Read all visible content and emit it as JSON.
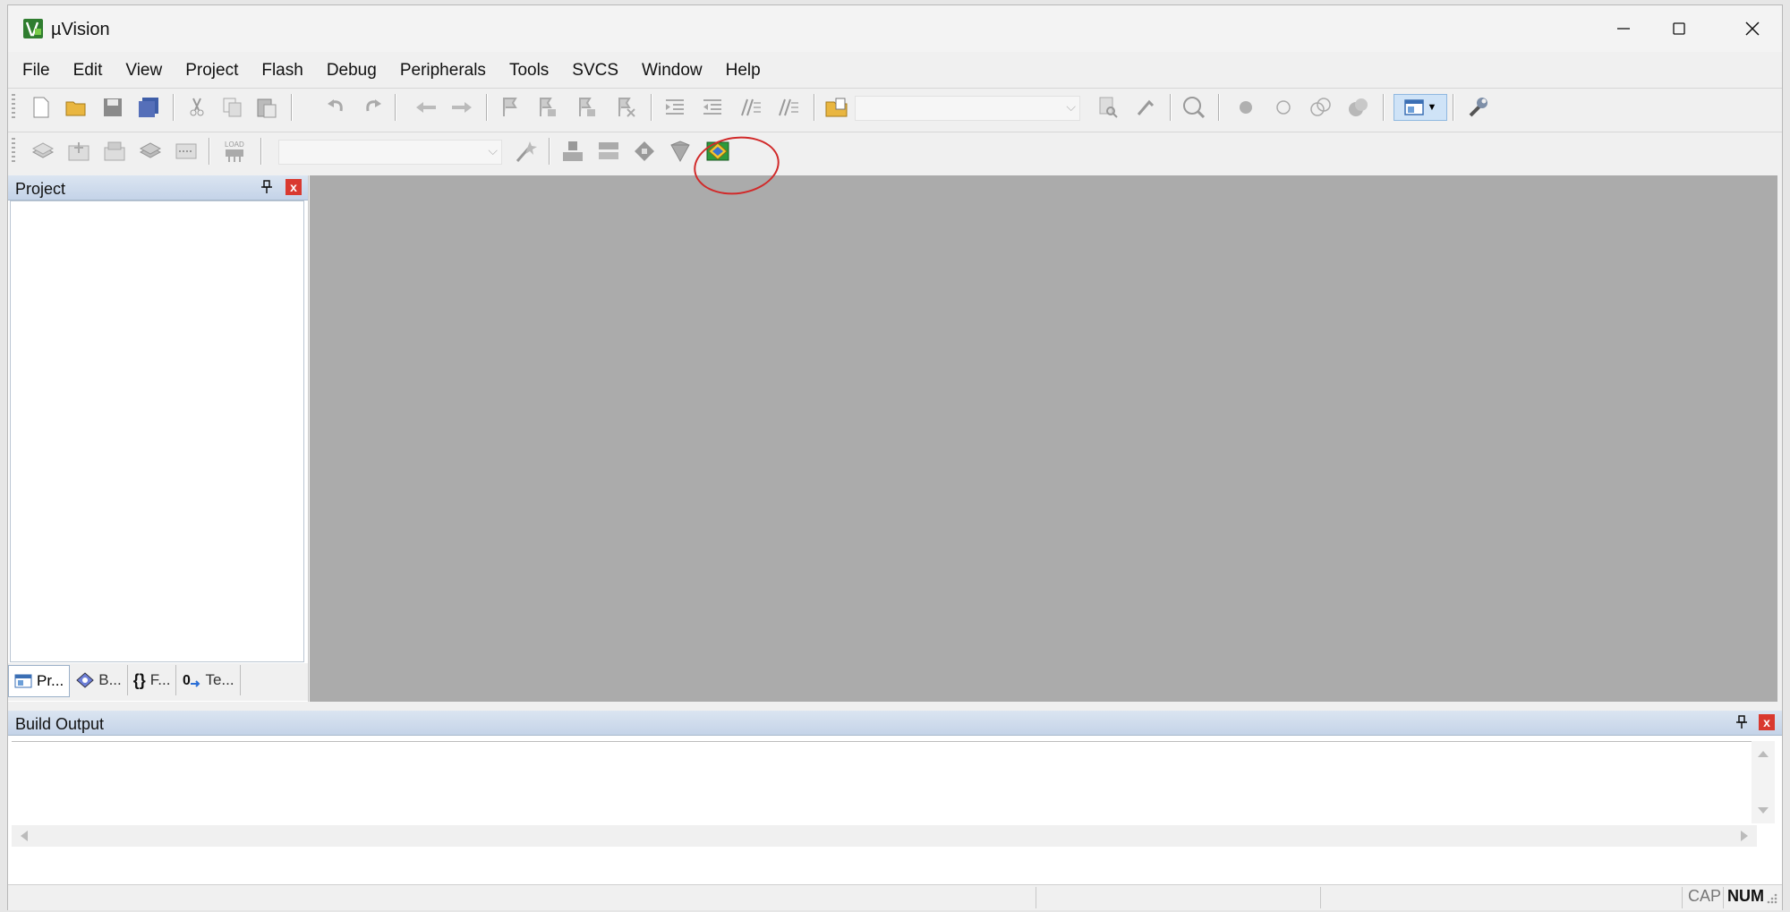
{
  "window": {
    "title": "µVision",
    "accent": "#3a8b3a"
  },
  "menubar": [
    "File",
    "Edit",
    "View",
    "Project",
    "Flash",
    "Debug",
    "Peripherals",
    "Tools",
    "SVCS",
    "Window",
    "Help"
  ],
  "toolbar1": [
    "new-file-icon",
    "open-folder-icon",
    "save-icon",
    "save-all-icon",
    "cut-icon",
    "copy-icon",
    "paste-icon",
    "undo-icon",
    "redo-icon",
    "nav-back-icon",
    "nav-forward-icon",
    "bookmark-icon",
    "prev-bookmark-icon",
    "next-bookmark-icon",
    "clear-bookmarks-icon",
    "indent-icon",
    "unindent-icon",
    "comment-icon",
    "uncomment-icon",
    "find-in-files-icon",
    "find-combo",
    "incremental-find-icon",
    "find-icon",
    "debug-session-icon",
    "breakpoint-icon",
    "disable-breakpoint-icon",
    "disable-all-breakpoints-icon",
    "kill-breakpoints-icon",
    "window-layout-icon",
    "configure-icon"
  ],
  "toolbar2": [
    "translate-icon",
    "build-icon",
    "rebuild-icon",
    "batch-build-icon",
    "stop-build-icon",
    "download-icon",
    "target-combo",
    "target-options-icon",
    "manage-project-icon",
    "event-recorder-icon",
    "manage-run-time-icon",
    "pack-installer-icon",
    "highlighted-icon"
  ],
  "project_panel": {
    "title": "Project",
    "pin": "📌",
    "close": "x",
    "tabs": [
      {
        "label": "Pr...",
        "icon": "project-tab-icon",
        "selected": true
      },
      {
        "label": "B...",
        "icon": "books-tab-icon",
        "selected": false
      },
      {
        "label": "F...",
        "icon": "functions-tab-icon",
        "selected": false
      },
      {
        "label": "Te...",
        "icon": "templates-tab-icon",
        "selected": false
      }
    ]
  },
  "build_output": {
    "title": "Build Output",
    "close": "x"
  },
  "statusbar": {
    "cap": "CAP",
    "num": "NUM"
  },
  "highlight_color": "#d12a2a"
}
